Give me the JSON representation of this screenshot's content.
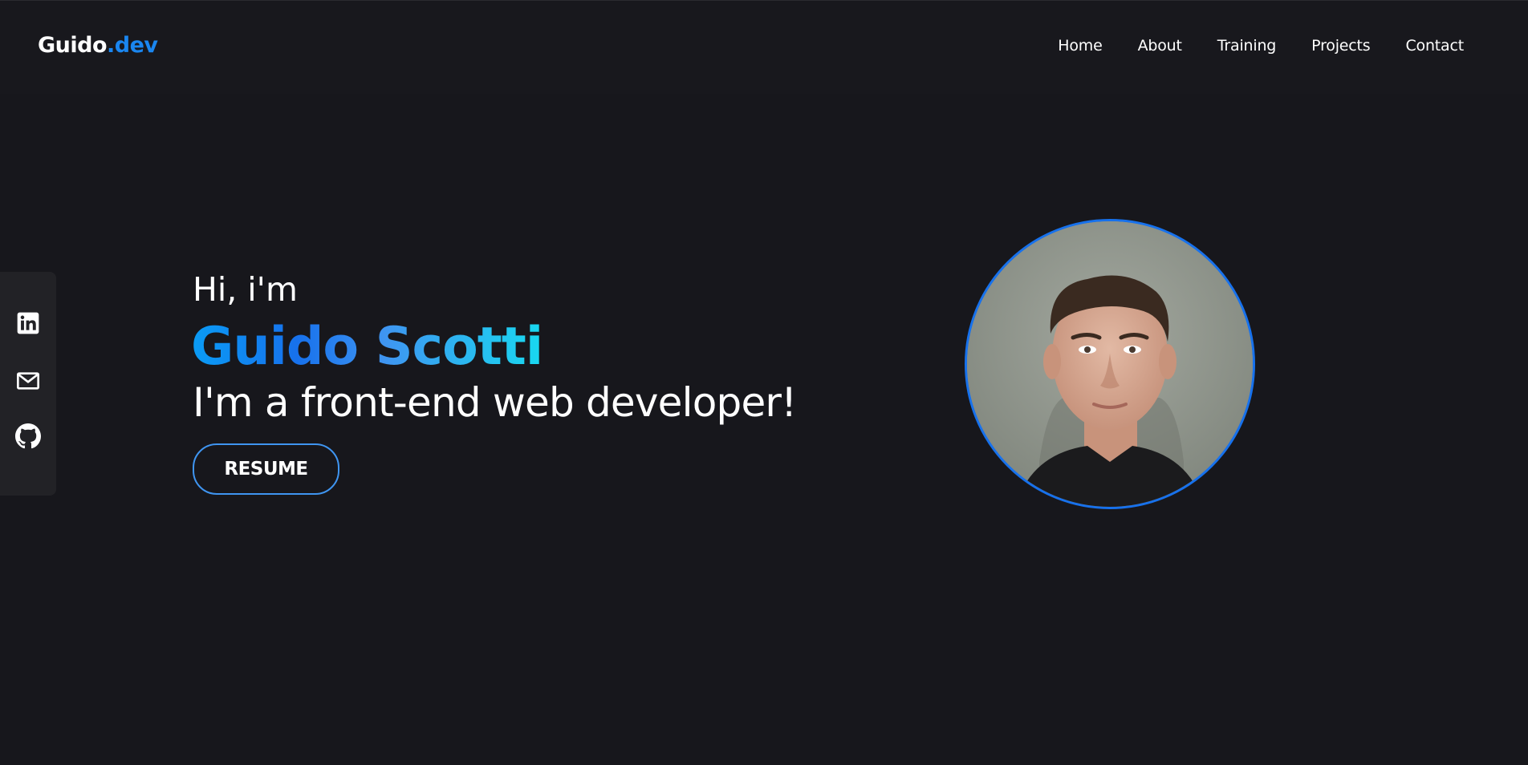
{
  "header": {
    "logo": {
      "name": "Guido",
      "tld": ".dev"
    },
    "nav": [
      "Home",
      "About",
      "Training",
      "Projects",
      "Contact"
    ]
  },
  "social": {
    "items": [
      {
        "icon": "linkedin-icon"
      },
      {
        "icon": "mail-icon"
      },
      {
        "icon": "github-icon"
      }
    ]
  },
  "hero": {
    "greeting": "Hi, i'm",
    "name": "Guido Scotti",
    "tagline": "I'm a front-end web developer!",
    "resume_label": "RESUME"
  },
  "colors": {
    "background": "#17171c",
    "header_background": "#18181d",
    "accent": "#1771ec",
    "accent_light": "#3f95f1",
    "accent_cyan": "#18d8f0",
    "sidebar_background": "#222226"
  }
}
